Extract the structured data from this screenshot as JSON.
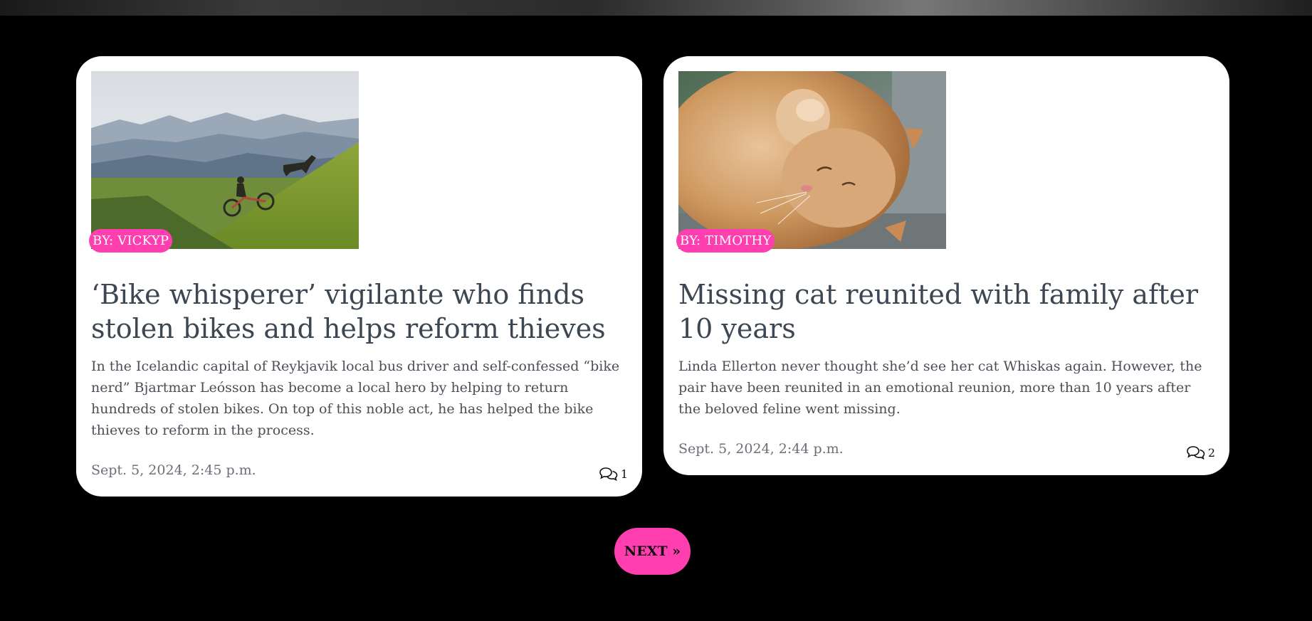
{
  "colors": {
    "background": "#000000",
    "card": "#ffffff",
    "accent": "#ff3fb0",
    "title": "#3d4653",
    "text": "#4a4f57",
    "muted": "#6b6f76"
  },
  "posts": [
    {
      "author": "BY: VICKYP",
      "title": "‘Bike whisperer’ vigilante who finds stolen bikes and helps reform thieves",
      "excerpt": "In the Icelandic capital of Reykjavik local bus driver and self-confessed “bike nerd” Bjartmar Leósson has become a local hero by helping to return hundreds of stolen bikes. On top of this noble act, he has helped the bike thieves to reform in the process.",
      "date": "Sept. 5, 2024, 2:45 p.m.",
      "comment_count": "1",
      "comment_icon": "comments-icon",
      "image_subject": "mountain-biker-icon"
    },
    {
      "author": "BY: TIMOTHY",
      "title": "Missing cat reunited with family after 10 years",
      "excerpt": "Linda Ellerton never thought she’d see her cat Whiskas again. However, the pair have been reunited in an emotional reunion, more than 10 years after the beloved feline went missing.",
      "date": "Sept. 5, 2024, 2:44 p.m.",
      "comment_count": "2",
      "comment_icon": "comments-icon",
      "image_subject": "sleeping-cat-icon"
    }
  ],
  "pagination": {
    "next_label": "NEXT »"
  }
}
